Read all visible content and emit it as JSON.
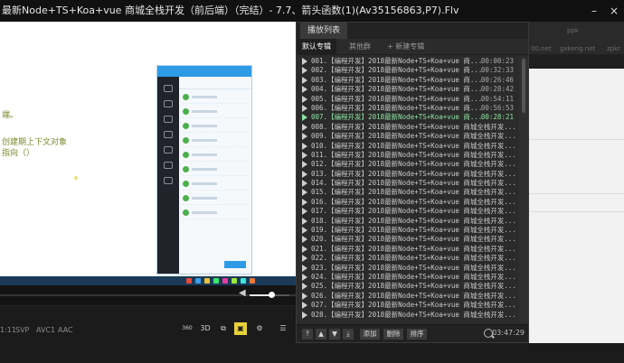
{
  "window": {
    "title": "最新Node+TS+Koa+vue 商城全栈开发（前后端）（完结）- 7.7、箭头函数(1)(Av35156863,P7).Flv",
    "minimize": "–",
    "close": "×"
  },
  "video": {
    "notes": [
      "端。",
      "创建期上下文对象",
      "指向（）"
    ]
  },
  "player": {
    "time_current": "1:11",
    "format_tags": [
      "SVP",
      "AVC1",
      "AAC"
    ],
    "buttons": {
      "vr": "360",
      "three_d": "3D",
      "snapshot": "⧉",
      "subtitle": "▣",
      "settings": "⚙",
      "menu": "☰"
    },
    "volume_icon": "◀",
    "volume_level": 0.55,
    "progress": 0.0
  },
  "playlist": {
    "panel_title": "播放列表",
    "tabs": [
      "默认专辑",
      "其他群",
      "+ 新建专辑"
    ],
    "prefix": "【编程开发】2018最新Node+TS+Koa+vue 商城全栈开发",
    "items": [
      {
        "n": "001.",
        "dur": "00:00:23"
      },
      {
        "n": "002.",
        "dur": "00:32:33"
      },
      {
        "n": "003.",
        "dur": "00:26:46"
      },
      {
        "n": "004.",
        "dur": "00:28:42"
      },
      {
        "n": "005.",
        "dur": "00:54:11"
      },
      {
        "n": "006.",
        "dur": "00:56:53"
      },
      {
        "n": "007.",
        "dur": "00:28:21"
      },
      {
        "n": "008.",
        "dur": ""
      },
      {
        "n": "009.",
        "dur": ""
      },
      {
        "n": "010.",
        "dur": ""
      },
      {
        "n": "011.",
        "dur": ""
      },
      {
        "n": "012.",
        "dur": ""
      },
      {
        "n": "013.",
        "dur": ""
      },
      {
        "n": "014.",
        "dur": ""
      },
      {
        "n": "015.",
        "dur": ""
      },
      {
        "n": "016.",
        "dur": ""
      },
      {
        "n": "017.",
        "dur": ""
      },
      {
        "n": "018.",
        "dur": ""
      },
      {
        "n": "019.",
        "dur": ""
      },
      {
        "n": "020.",
        "dur": ""
      },
      {
        "n": "021.",
        "dur": ""
      },
      {
        "n": "022.",
        "dur": ""
      },
      {
        "n": "023.",
        "dur": ""
      },
      {
        "n": "024.",
        "dur": ""
      },
      {
        "n": "025.",
        "dur": ""
      },
      {
        "n": "026.",
        "dur": ""
      },
      {
        "n": "027.",
        "dur": ""
      },
      {
        "n": "028.",
        "dur": ""
      }
    ],
    "current_index": 6,
    "footer": {
      "move_top": "⤒",
      "move_up": "▲",
      "move_down": "▼",
      "move_bottom": "⤓",
      "add": "添加",
      "delete": "删除",
      "sort": "排序",
      "time": "03:47:29"
    }
  },
  "right_fragments": {
    "texts": [
      "ppk",
      "00.net",
      "gxkeng.net",
      "zpkr"
    ]
  },
  "colors": {
    "accent_green": "#8ee3a2",
    "qq_blue": "#2e9be6"
  }
}
